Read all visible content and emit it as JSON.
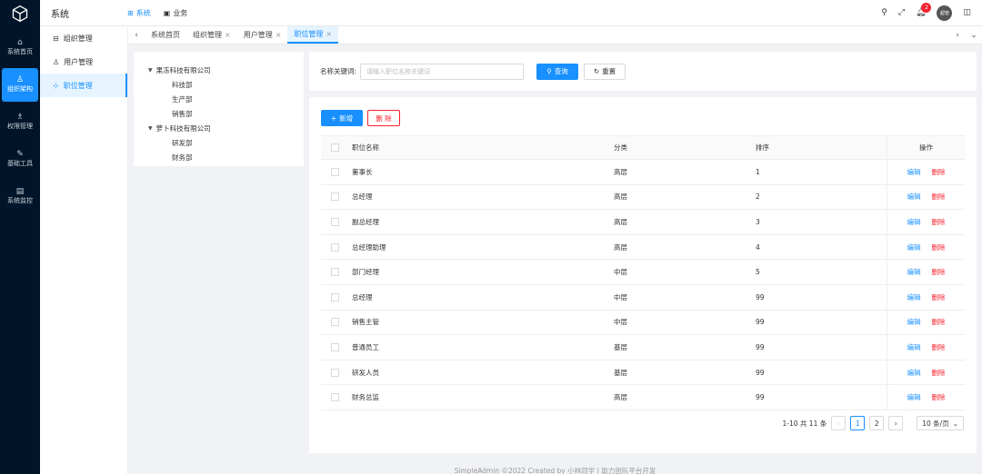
{
  "rail": {
    "items": [
      {
        "label": "系统首页",
        "icon": "home-icon"
      },
      {
        "label": "组织架构",
        "icon": "org-icon"
      },
      {
        "label": "权限管理",
        "icon": "user-lock-icon"
      },
      {
        "label": "基础工具",
        "icon": "tool-icon"
      },
      {
        "label": "系统监控",
        "icon": "monitor-icon"
      }
    ]
  },
  "header": {
    "title": "系统",
    "nav": [
      {
        "label": "系统",
        "icon": "grid-icon"
      },
      {
        "label": "业务",
        "icon": "box-icon"
      }
    ],
    "notification_count": "2",
    "avatar_text": "超管"
  },
  "submenu": {
    "items": [
      {
        "label": "组织管理",
        "icon": "org-small-icon"
      },
      {
        "label": "用户管理",
        "icon": "user-icon"
      },
      {
        "label": "职位管理",
        "icon": "position-icon"
      }
    ]
  },
  "tabs": [
    {
      "label": "系统首页"
    },
    {
      "label": "组织管理"
    },
    {
      "label": "用户管理"
    },
    {
      "label": "职位管理"
    }
  ],
  "tree": {
    "companies": [
      {
        "name": "果冻科技有限公司",
        "departments": [
          "科技部",
          "生产部",
          "销售部"
        ]
      },
      {
        "name": "萝卜科技有限公司",
        "departments": [
          "研发部",
          "财务部"
        ]
      }
    ]
  },
  "search": {
    "label": "名称关键词:",
    "placeholder": "请输入职位名称关键词",
    "query_label": "查询",
    "reset_label": "重置"
  },
  "table": {
    "add_label": "新增",
    "delete_label": "删 除",
    "columns": {
      "name": "职位名称",
      "type": "分类",
      "sort": "排序",
      "ops": "操作"
    },
    "edit_text": "编辑",
    "del_text": "删除",
    "rows": [
      {
        "name": "董事长",
        "type": "高层",
        "sort": "1"
      },
      {
        "name": "总经理",
        "type": "高层",
        "sort": "2"
      },
      {
        "name": "副总经理",
        "type": "高层",
        "sort": "3"
      },
      {
        "name": "总经理助理",
        "type": "高层",
        "sort": "4"
      },
      {
        "name": "部门经理",
        "type": "中层",
        "sort": "5"
      },
      {
        "name": "总经理",
        "type": "中层",
        "sort": "99"
      },
      {
        "name": "销售主管",
        "type": "中层",
        "sort": "99"
      },
      {
        "name": "普通员工",
        "type": "基层",
        "sort": "99"
      },
      {
        "name": "研发人员",
        "type": "基层",
        "sort": "99"
      },
      {
        "name": "财务总监",
        "type": "高层",
        "sort": "99"
      }
    ]
  },
  "pagination": {
    "summary": "1-10 共 11 条",
    "pages": [
      "1",
      "2"
    ],
    "page_size": "10 条/页"
  },
  "footer": {
    "text": "SimpleAdmin ©2022 Created by 小林同学 | 助力团队平台开发"
  }
}
